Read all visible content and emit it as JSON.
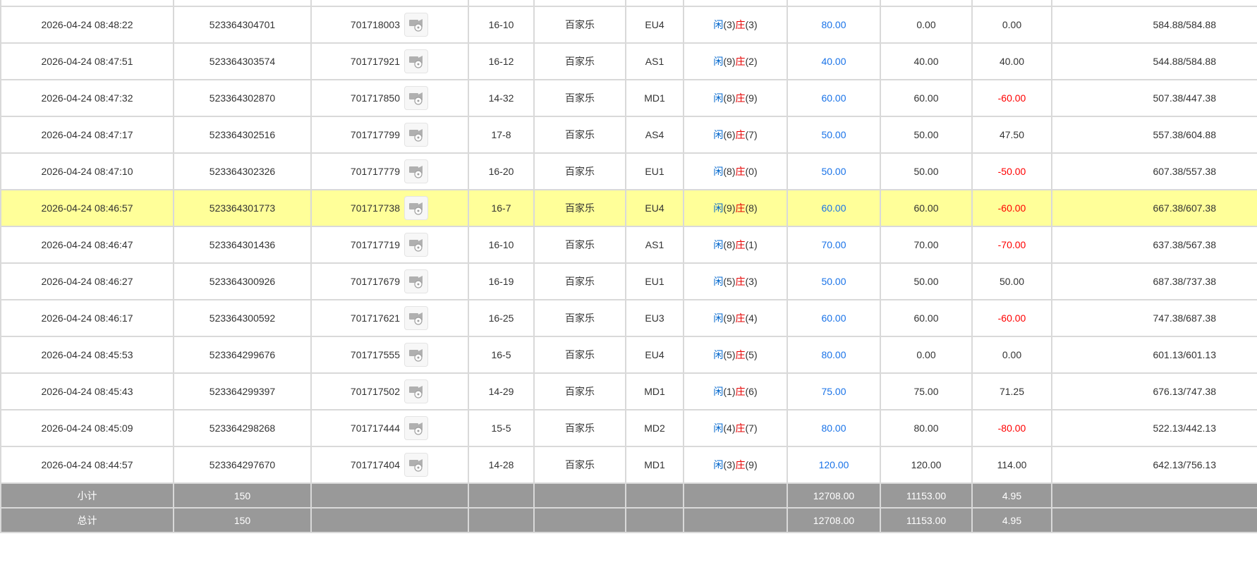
{
  "rows": [
    {
      "time": "2026-04-24 08:48:22",
      "bet_id": "523364304701",
      "game_id": "701718003",
      "shoe": "16-10",
      "game": "百家乐",
      "table": "EU4",
      "p_label": "闲",
      "p": "(3)",
      "b_label": "庄",
      "b": "(3)",
      "bet": "80.00",
      "valid": "0.00",
      "win": "0.00",
      "win_neg": false,
      "balance": "584.88/584.88"
    },
    {
      "time": "2026-04-24 08:47:51",
      "bet_id": "523364303574",
      "game_id": "701717921",
      "shoe": "16-12",
      "game": "百家乐",
      "table": "AS1",
      "p_label": "闲",
      "p": "(9)",
      "b_label": "庄",
      "b": "(2)",
      "bet": "40.00",
      "valid": "40.00",
      "win": "40.00",
      "win_neg": false,
      "balance": "544.88/584.88"
    },
    {
      "time": "2026-04-24 08:47:32",
      "bet_id": "523364302870",
      "game_id": "701717850",
      "shoe": "14-32",
      "game": "百家乐",
      "table": "MD1",
      "p_label": "闲",
      "p": "(8)",
      "b_label": "庄",
      "b": "(9)",
      "bet": "60.00",
      "valid": "60.00",
      "win": "-60.00",
      "win_neg": true,
      "balance": "507.38/447.38"
    },
    {
      "time": "2026-04-24 08:47:17",
      "bet_id": "523364302516",
      "game_id": "701717799",
      "shoe": "17-8",
      "game": "百家乐",
      "table": "AS4",
      "p_label": "闲",
      "p": "(6)",
      "b_label": "庄",
      "b": "(7)",
      "bet": "50.00",
      "valid": "50.00",
      "win": "47.50",
      "win_neg": false,
      "balance": "557.38/604.88"
    },
    {
      "time": "2026-04-24 08:47:10",
      "bet_id": "523364302326",
      "game_id": "701717779",
      "shoe": "16-20",
      "game": "百家乐",
      "table": "EU1",
      "p_label": "闲",
      "p": "(8)",
      "b_label": "庄",
      "b": "(0)",
      "bet": "50.00",
      "valid": "50.00",
      "win": "-50.00",
      "win_neg": true,
      "balance": "607.38/557.38"
    },
    {
      "time": "2026-04-24 08:46:57",
      "bet_id": "523364301773",
      "game_id": "701717738",
      "shoe": "16-7",
      "game": "百家乐",
      "table": "EU4",
      "p_label": "闲",
      "p": "(9)",
      "b_label": "庄",
      "b": "(8)",
      "bet": "60.00",
      "valid": "60.00",
      "win": "-60.00",
      "win_neg": true,
      "balance": "667.38/607.38",
      "highlight": true
    },
    {
      "time": "2026-04-24 08:46:47",
      "bet_id": "523364301436",
      "game_id": "701717719",
      "shoe": "16-10",
      "game": "百家乐",
      "table": "AS1",
      "p_label": "闲",
      "p": "(8)",
      "b_label": "庄",
      "b": "(1)",
      "bet": "70.00",
      "valid": "70.00",
      "win": "-70.00",
      "win_neg": true,
      "balance": "637.38/567.38"
    },
    {
      "time": "2026-04-24 08:46:27",
      "bet_id": "523364300926",
      "game_id": "701717679",
      "shoe": "16-19",
      "game": "百家乐",
      "table": "EU1",
      "p_label": "闲",
      "p": "(5)",
      "b_label": "庄",
      "b": "(3)",
      "bet": "50.00",
      "valid": "50.00",
      "win": "50.00",
      "win_neg": false,
      "balance": "687.38/737.38"
    },
    {
      "time": "2026-04-24 08:46:17",
      "bet_id": "523364300592",
      "game_id": "701717621",
      "shoe": "16-25",
      "game": "百家乐",
      "table": "EU3",
      "p_label": "闲",
      "p": "(9)",
      "b_label": "庄",
      "b": "(4)",
      "bet": "60.00",
      "valid": "60.00",
      "win": "-60.00",
      "win_neg": true,
      "balance": "747.38/687.38"
    },
    {
      "time": "2026-04-24 08:45:53",
      "bet_id": "523364299676",
      "game_id": "701717555",
      "shoe": "16-5",
      "game": "百家乐",
      "table": "EU4",
      "p_label": "闲",
      "p": "(5)",
      "b_label": "庄",
      "b": "(5)",
      "bet": "80.00",
      "valid": "0.00",
      "win": "0.00",
      "win_neg": false,
      "balance": "601.13/601.13"
    },
    {
      "time": "2026-04-24 08:45:43",
      "bet_id": "523364299397",
      "game_id": "701717502",
      "shoe": "14-29",
      "game": "百家乐",
      "table": "MD1",
      "p_label": "闲",
      "p": "(1)",
      "b_label": "庄",
      "b": "(6)",
      "bet": "75.00",
      "valid": "75.00",
      "win": "71.25",
      "win_neg": false,
      "balance": "676.13/747.38"
    },
    {
      "time": "2026-04-24 08:45:09",
      "bet_id": "523364298268",
      "game_id": "701717444",
      "shoe": "15-5",
      "game": "百家乐",
      "table": "MD2",
      "p_label": "闲",
      "p": "(4)",
      "b_label": "庄",
      "b": "(7)",
      "bet": "80.00",
      "valid": "80.00",
      "win": "-80.00",
      "win_neg": true,
      "balance": "522.13/442.13"
    },
    {
      "time": "2026-04-24 08:44:57",
      "bet_id": "523364297670",
      "game_id": "701717404",
      "shoe": "14-28",
      "game": "百家乐",
      "table": "MD1",
      "p_label": "闲",
      "p": "(3)",
      "b_label": "庄",
      "b": "(9)",
      "bet": "120.00",
      "valid": "120.00",
      "win": "114.00",
      "win_neg": false,
      "balance": "642.13/756.13"
    }
  ],
  "subtotal": {
    "label": "小计",
    "count": "150",
    "bet": "12708.00",
    "valid": "11153.00",
    "win": "4.95"
  },
  "total": {
    "label": "总计",
    "count": "150",
    "bet": "12708.00",
    "valid": "11153.00",
    "win": "4.95"
  },
  "icons": {
    "replay": "video-replay-icon"
  },
  "colors": {
    "highlight": "#ffff99",
    "footer": "#999999",
    "player": "#0066cc",
    "banker": "#e60000",
    "bet": "#1a73e8",
    "loss": "#ff0000"
  }
}
